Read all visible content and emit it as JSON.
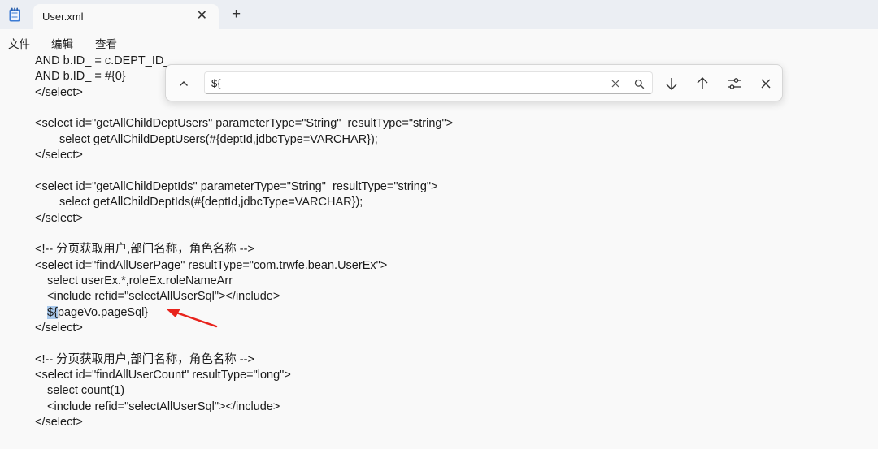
{
  "tab": {
    "title": "User.xml",
    "close_glyph": "✕",
    "new_tab_glyph": "+"
  },
  "menu": {
    "items": [
      "文件",
      "编辑",
      "查看"
    ]
  },
  "editor": {
    "lines": [
      {
        "text": "AND b.ID_ = c.DEPT_ID_",
        "indent": 0
      },
      {
        "text": "AND b.ID_ = #{0}",
        "indent": 0
      },
      {
        "text": "</select>",
        "indent": 0
      },
      {
        "text": "",
        "indent": 0
      },
      {
        "text": "<select id=\"getAllChildDeptUsers\" parameterType=\"String\"  resultType=\"string\">",
        "indent": 0
      },
      {
        "text": "select getAllChildDeptUsers(#{deptId,jdbcType=VARCHAR});",
        "indent": 2
      },
      {
        "text": "</select>",
        "indent": 0
      },
      {
        "text": "",
        "indent": 0
      },
      {
        "text": "<select id=\"getAllChildDeptIds\" parameterType=\"String\"  resultType=\"string\">",
        "indent": 0
      },
      {
        "text": "select getAllChildDeptIds(#{deptId,jdbcType=VARCHAR});",
        "indent": 2
      },
      {
        "text": "</select>",
        "indent": 0
      },
      {
        "text": "",
        "indent": 0
      },
      {
        "text": "<!-- 分页获取用户,部门名称，角色名称 -->",
        "indent": 0
      },
      {
        "text": "<select id=\"findAllUserPage\" resultType=\"com.trwfe.bean.UserEx\">",
        "indent": 0
      },
      {
        "text": "select userEx.*,roleEx.roleNameArr",
        "indent": 1
      },
      {
        "text": "<include refid=\"selectAllUserSql\"></include>",
        "indent": 1
      },
      {
        "text": "${pageVo.pageSql}",
        "indent": 1,
        "highlight": "${"
      },
      {
        "text": "</select>",
        "indent": 0
      },
      {
        "text": "",
        "indent": 0
      },
      {
        "text": "<!-- 分页获取用户,部门名称，角色名称 -->",
        "indent": 0
      },
      {
        "text": "<select id=\"findAllUserCount\" resultType=\"long\">",
        "indent": 0
      },
      {
        "text": "select count(1)",
        "indent": 1
      },
      {
        "text": "<include refid=\"selectAllUserSql\"></include>",
        "indent": 1
      },
      {
        "text": "</select>",
        "indent": 0
      }
    ]
  },
  "find": {
    "query": "${",
    "icons": {
      "collapse": "chevron-up-icon",
      "clear": "clear-x-icon",
      "search": "search-icon",
      "next": "arrow-down-icon",
      "previous": "arrow-up-icon",
      "options": "sliders-icon",
      "close": "close-icon"
    }
  },
  "annotation": {
    "arrow_color": "#e8231c"
  }
}
